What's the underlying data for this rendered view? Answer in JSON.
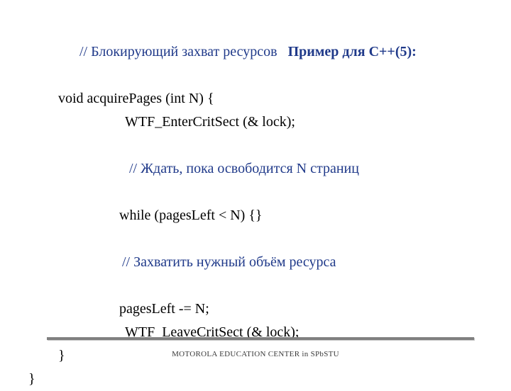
{
  "content": {
    "title_comment": "// Блокирующий захват ресурсов   ",
    "title_bold": "Пример для С++(5):",
    "line1": "void acquirePages (int N) {",
    "line2": "WTF_EnterCritSect (& lock);",
    "comment_wait": "// Ждать, пока освободится N страниц",
    "line3": "while (pagesLeft < N) {}",
    "comment_grab": "// Захватить нужный объём ресурса",
    "line4": "pagesLeft -= N;",
    "line5": "WTF_LeaveCritSect (& lock);",
    "brace1": "}",
    "brace2": "}"
  },
  "footer": "MOTOROLA EDUCATION CENTER in SPbSTU",
  "colors": {
    "comment": "#203a8a",
    "text": "#000000",
    "rule": "#808080"
  }
}
